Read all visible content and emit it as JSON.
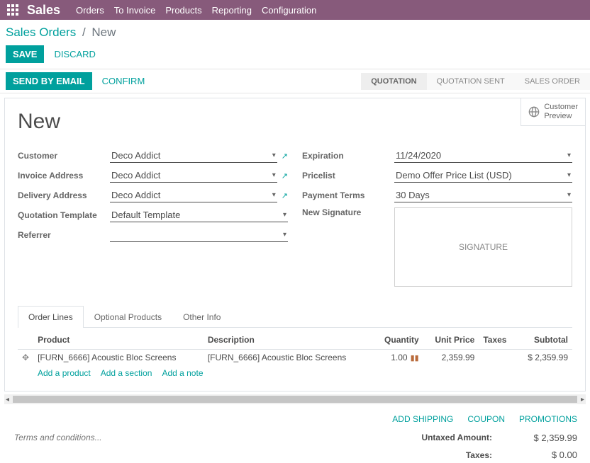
{
  "topbar": {
    "brand": "Sales",
    "nav": [
      "Orders",
      "To Invoice",
      "Products",
      "Reporting",
      "Configuration"
    ]
  },
  "breadcrumb": {
    "root": "Sales Orders",
    "current": "New"
  },
  "cp": {
    "save": "SAVE",
    "discard": "DISCARD"
  },
  "statusbar": {
    "send": "SEND BY EMAIL",
    "confirm": "CONFIRM",
    "steps": {
      "quotation": "QUOTATION",
      "sent": "QUOTATION SENT",
      "order": "SALES ORDER"
    }
  },
  "button_box": {
    "customer_preview_l1": "Customer",
    "customer_preview_l2": "Preview"
  },
  "title": "New",
  "left_labels": {
    "customer": "Customer",
    "invoice_addr": "Invoice Address",
    "delivery_addr": "Delivery Address",
    "quote_tmpl": "Quotation Template",
    "referrer": "Referrer"
  },
  "left_values": {
    "customer": "Deco Addict",
    "invoice_addr": "Deco Addict",
    "delivery_addr": "Deco Addict",
    "quote_tmpl": "Default Template",
    "referrer": ""
  },
  "right_labels": {
    "expiration": "Expiration",
    "pricelist": "Pricelist",
    "payment_terms": "Payment Terms",
    "new_signature": "New Signature"
  },
  "right_values": {
    "expiration": "11/24/2020",
    "pricelist": "Demo Offer Price List (USD)",
    "payment_terms": "30 Days"
  },
  "signature_placeholder": "SIGNATURE",
  "tabs": {
    "order_lines": "Order Lines",
    "optional": "Optional Products",
    "other": "Other Info"
  },
  "table": {
    "cols": {
      "product": "Product",
      "description": "Description",
      "quantity": "Quantity",
      "unit_price": "Unit Price",
      "taxes": "Taxes",
      "subtotal": "Subtotal"
    },
    "rows": [
      {
        "product": "[FURN_6666] Acoustic Bloc Screens",
        "description": "[FURN_6666] Acoustic Bloc Screens",
        "quantity": "1.00",
        "unit_price": "2,359.99",
        "taxes": "",
        "subtotal": "$ 2,359.99"
      }
    ],
    "links": {
      "add_product": "Add a product",
      "add_section": "Add a section",
      "add_note": "Add a note"
    }
  },
  "footer_links": {
    "shipping": "ADD SHIPPING",
    "coupon": "COUPON",
    "promotions": "PROMOTIONS"
  },
  "terms_placeholder": "Terms and conditions...",
  "totals": {
    "untaxed_label": "Untaxed Amount:",
    "untaxed_value": "$ 2,359.99",
    "taxes_label": "Taxes:",
    "taxes_value": "$ 0.00"
  }
}
